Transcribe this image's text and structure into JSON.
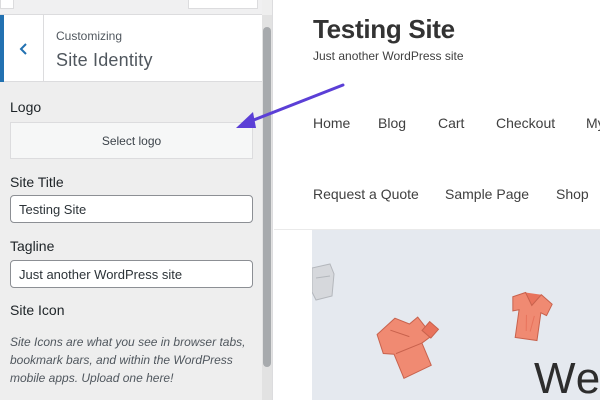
{
  "customizer": {
    "breadcrumb": "Customizing",
    "section_title": "Site Identity",
    "logo": {
      "label": "Logo",
      "button_label": "Select logo"
    },
    "site_title": {
      "label": "Site Title",
      "value": "Testing Site"
    },
    "tagline": {
      "label": "Tagline",
      "value": "Just another WordPress site"
    },
    "site_icon": {
      "label": "Site Icon",
      "description": "Site Icons are what you see in browser tabs, bookmark bars, and within the WordPress mobile apps. Upload one here!"
    }
  },
  "preview": {
    "site_title": "Testing Site",
    "tagline": "Just another WordPress site",
    "menu": [
      "Home",
      "Blog",
      "Cart",
      "Checkout",
      "My",
      "Request a Quote",
      "Sample Page",
      "Shop"
    ],
    "hero_heading": "We"
  },
  "colors": {
    "accent": "#2271b1",
    "annotation_arrow": "#5b3fd6",
    "panel_bg": "#eeeeee",
    "hero_bg": "#e5e9ef",
    "shirt": "#f08a72"
  },
  "icons": {
    "back": "chevron-left-icon",
    "annotation": "arrow-pointer-icon"
  }
}
